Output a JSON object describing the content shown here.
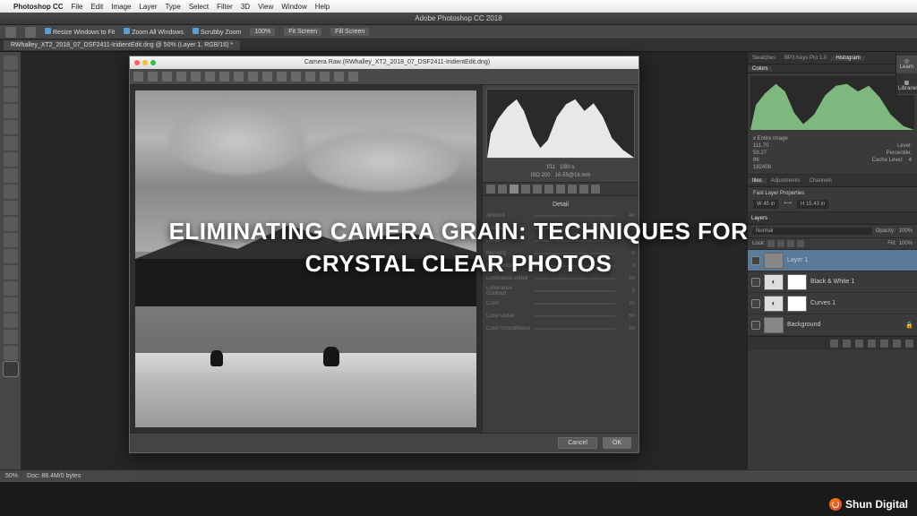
{
  "mac_menu": {
    "app": "Photoshop CC",
    "items": [
      "File",
      "Edit",
      "Image",
      "Layer",
      "Type",
      "Select",
      "Filter",
      "3D",
      "View",
      "Window",
      "Help"
    ]
  },
  "app_title": "Adobe Photoshop CC 2018",
  "options_bar": {
    "resize": "Resize Windows to Fit",
    "zoom_all": "Zoom All Windows",
    "scrubby": "Scrubby Zoom",
    "pct": "100%",
    "fit": "Fit Screen",
    "fill": "Fill Screen"
  },
  "doc_tab": "RWhalley_XT2_2018_07_DSF2411-IridientEdit.dng @ 50% (Layer 1, RGB/16) *",
  "acr": {
    "title": "Camera Raw (RWhalley_XT2_2018_07_DSF2411-IridientEdit.dng)",
    "readout": {
      "f": "f/11",
      "shutter": "1/80 s",
      "iso": "ISO 200",
      "lens": "16-55@16 mm"
    },
    "panel_title": "Detail",
    "sliders": [
      {
        "label": "Amount",
        "val": "40"
      },
      {
        "label": "Radius",
        "val": "1.0"
      },
      {
        "label": "Detail",
        "val": "25"
      },
      {
        "label": "Masking",
        "val": "0"
      },
      {
        "label": "Luminance",
        "val": "0"
      },
      {
        "label": "Luminance Detail",
        "val": "50"
      },
      {
        "label": "Luminance Contrast",
        "val": "0"
      },
      {
        "label": "Color",
        "val": "25"
      },
      {
        "label": "Color Detail",
        "val": "50"
      },
      {
        "label": "Color Smoothness",
        "val": "50"
      }
    ],
    "cancel": "Cancel",
    "ok": "OK"
  },
  "right": {
    "top_tabs": [
      "Swatches",
      "BP3 Keys Pro 1.0",
      "Histogram"
    ],
    "colors_tab": "Colors",
    "info": {
      "header": "x Entire Image",
      "rows": [
        {
          "a": "111.70",
          "b": "Level:"
        },
        {
          "a": "59.27",
          "b": "Percentile:"
        },
        {
          "a": "86",
          "b": "Cache Level:",
          "c": "4"
        },
        {
          "a": "182408",
          "b": "",
          "c": ""
        }
      ]
    },
    "mid_tabs": [
      "tiles",
      "Adjustments",
      "Channels"
    ],
    "fast_props": {
      "title": "Fast Layer Properties",
      "w": "45 in",
      "h": "15.43 in"
    },
    "layers": {
      "tab": "Layers",
      "blend": "Normal",
      "opacity_label": "Opacity:",
      "opacity": "100%",
      "lock": "Lock:",
      "fill_label": "Fill:",
      "fill": "100%",
      "items": [
        {
          "name": "Layer 1",
          "sel": true,
          "thumb": "photo"
        },
        {
          "name": "Black & White 1",
          "sel": false,
          "thumb": "adj",
          "mask": true
        },
        {
          "name": "Curves 1",
          "sel": false,
          "thumb": "adj",
          "mask": true
        },
        {
          "name": "Background",
          "sel": false,
          "thumb": "photo",
          "locked": true
        }
      ]
    }
  },
  "collapsed": {
    "learn": "Learn",
    "libraries": "Libraries"
  },
  "status": {
    "zoom": "50%",
    "doc": "Doc: 88.4M/0 bytes"
  },
  "overlay": {
    "line1": "ELIMINATING CAMERA GRAIN: TECHNIQUES FOR",
    "line2": "CRYSTAL CLEAR PHOTOS"
  },
  "brand": "Shun Digital"
}
